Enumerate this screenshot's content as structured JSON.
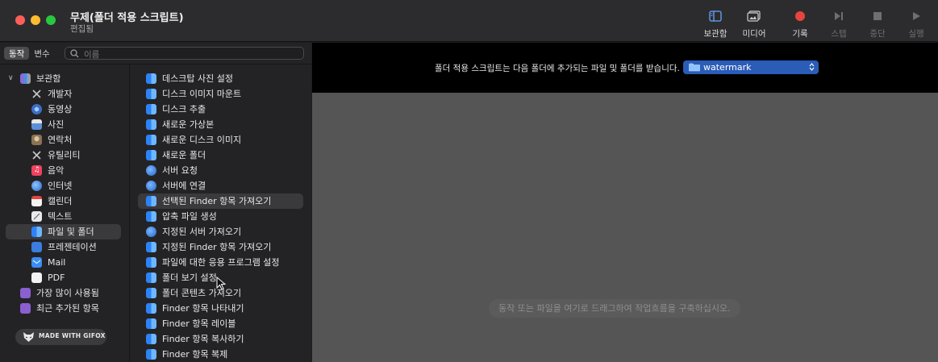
{
  "window": {
    "title": "무제(폴더 적용 스크립트)",
    "subtitle": "편집됨"
  },
  "toolbar": {
    "library_label": "보관함",
    "media_label": "미디어",
    "record_label": "기록",
    "step_label": "스텝",
    "stop_label": "중단",
    "run_label": "실행",
    "record_color": "#e5453d"
  },
  "leftpane": {
    "tabs": [
      "동작",
      "변수"
    ],
    "search_placeholder": "이름",
    "library": {
      "root": "보관함",
      "items": [
        "개발자",
        "동영상",
        "사진",
        "연락처",
        "유틸리티",
        "음악",
        "인터넷",
        "캘린더",
        "텍스트",
        "파일 및 폴더",
        "프레젠테이션",
        "Mail",
        "PDF"
      ],
      "selected": "파일 및 폴더",
      "smart": [
        "가장 많이 사용됨",
        "최근 추가된 항목"
      ]
    },
    "actions": [
      "데스크탑 사진 설정",
      "디스크 이미지 마운트",
      "디스크 추출",
      "새로운 가상본",
      "새로운 디스크 이미지",
      "새로운 폴더",
      "서버 요청",
      "서버에 연결",
      "선택된 Finder 항목 가져오기",
      "압축 파일 생성",
      "지정된 서버 가져오기",
      "지정된 Finder 항목 가져오기",
      "파일에 대한 응용 프로그램 설정",
      "폴더 보기 설정",
      "폴더 콘텐츠 가져오기",
      "Finder 항목 나타내기",
      "Finder 항목 레이블",
      "Finder 항목 복사하기",
      "Finder 항목 복제"
    ],
    "selected_action": "선택된 Finder 항목 가져오기",
    "watermark": "MADE WITH GIFOX"
  },
  "workflow": {
    "description": "폴더 적용 스크립트는 다음 폴더에 추가되는 파일 및 폴더를 받습니다.",
    "folder_value": "watermark",
    "empty_hint": "동작 또는 파일을 여기로 드래그하여 작업흐름을 구축하십시오."
  }
}
